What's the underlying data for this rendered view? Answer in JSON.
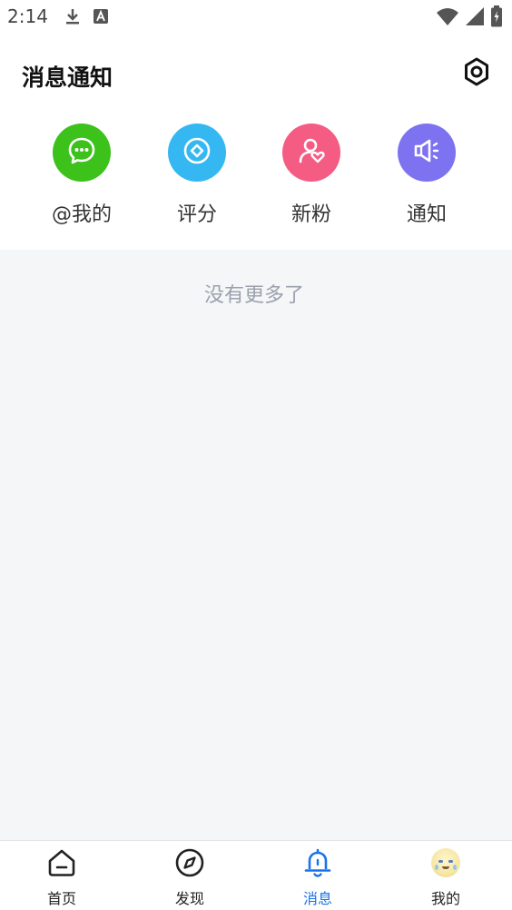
{
  "status_bar": {
    "time": "2:14",
    "icons": [
      "download-icon",
      "a-box-icon",
      "wifi-icon",
      "cellular-icon",
      "battery-icon"
    ]
  },
  "header": {
    "title": "消息通知",
    "settings_icon": "gear-icon"
  },
  "categories": [
    {
      "label": "@我的",
      "icon": "chat-bubble-icon",
      "color": "#3cc21a"
    },
    {
      "label": "评分",
      "icon": "diamond-icon",
      "color": "#35b8f2"
    },
    {
      "label": "新粉",
      "icon": "user-heart-icon",
      "color": "#f45c84"
    },
    {
      "label": "通知",
      "icon": "speaker-icon",
      "color": "#7d72ef"
    }
  ],
  "empty_state": {
    "text": "没有更多了"
  },
  "bottom_nav": {
    "items": [
      {
        "label": "首页",
        "icon": "home-icon",
        "active": false
      },
      {
        "label": "发现",
        "icon": "compass-icon",
        "active": false
      },
      {
        "label": "消息",
        "icon": "bell-icon",
        "active": true
      },
      {
        "label": "我的",
        "icon": "avatar",
        "active": false
      }
    ],
    "active_color": "#1a73e8"
  }
}
